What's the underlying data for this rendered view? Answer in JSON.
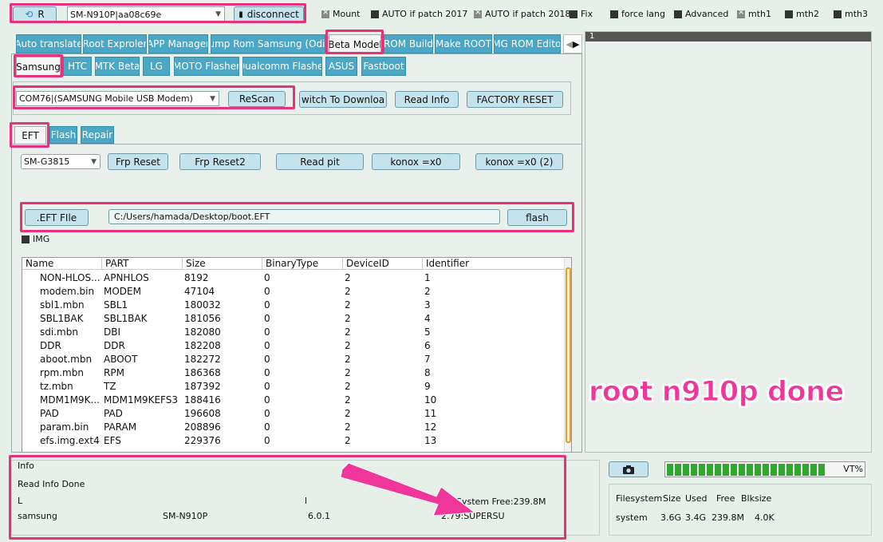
{
  "toolbar": {
    "r_button": "R",
    "device_combo": "SM-N910P|aa08c69e",
    "disconnect_button": "disconnect",
    "checkboxes": [
      {
        "label": "Mount",
        "checked": true
      },
      {
        "label": "AUTO if patch 2017",
        "checked": false
      },
      {
        "label": "AUTO if patch 2018",
        "checked": true
      },
      {
        "label": "Fix",
        "checked": false
      },
      {
        "label": "force lang",
        "checked": false
      },
      {
        "label": "Advanced",
        "checked": false
      },
      {
        "label": "mth1",
        "checked": true
      },
      {
        "label": "mth2",
        "checked": false
      },
      {
        "label": "mth3",
        "checked": false
      }
    ]
  },
  "main_tabs": [
    "Auto translate",
    "Root Exproler",
    "APP Manager",
    "Dump Rom Samsung (Odin)",
    "Beta Model",
    "ROM Build",
    "Make ROOT",
    "IMG ROM Editor"
  ],
  "brand_tabs": [
    "Samsung",
    "HTC",
    "MTK Beta",
    "LG",
    "MOTO Flasher",
    "Qualcomm Flasher",
    "ASUS",
    "Fastboot"
  ],
  "port": {
    "combo": "COM76|(SAMSUNG Mobile USB Modem)",
    "rescan": "ReScan",
    "switch_download": "witch To Downloa",
    "read_info": "Read Info",
    "factory_reset": "FACTORY RESET"
  },
  "sub_tabs": [
    "EFT",
    "Flash",
    "Repair"
  ],
  "eft": {
    "model_combo": "SM-G3815",
    "frp_reset": "Frp Reset",
    "frp_reset2": "Frp Reset2",
    "read_pit": "Read pit",
    "konox": "konox =x0",
    "konox2": "konox =x0 (2)",
    "eft_file_button": ".EFT FIle",
    "path": "C:/Users/hamada/Desktop/boot.EFT",
    "flash_button": "flash",
    "img_label": "IMG"
  },
  "table": {
    "headers": [
      "Name",
      "PART",
      "Size",
      "BinaryType",
      "DeviceID",
      "Identifier"
    ],
    "rows": [
      [
        "NON-HLOS...",
        "APNHLOS",
        "8192",
        "0",
        "2",
        "1"
      ],
      [
        "modem.bin",
        "MODEM",
        "47104",
        "0",
        "2",
        "2"
      ],
      [
        "sbl1.mbn",
        "SBL1",
        "180032",
        "0",
        "2",
        "3"
      ],
      [
        "SBL1BAK",
        "SBL1BAK",
        "181056",
        "0",
        "2",
        "4"
      ],
      [
        "sdi.mbn",
        "DBI",
        "182080",
        "0",
        "2",
        "5"
      ],
      [
        "DDR",
        "DDR",
        "182208",
        "0",
        "2",
        "6"
      ],
      [
        "aboot.mbn",
        "ABOOT",
        "182272",
        "0",
        "2",
        "7"
      ],
      [
        "rpm.mbn",
        "RPM",
        "186368",
        "0",
        "2",
        "8"
      ],
      [
        "tz.mbn",
        "TZ",
        "187392",
        "0",
        "2",
        "9"
      ],
      [
        "MDM1M9K...",
        "MDM1M9KEFS3",
        "188416",
        "0",
        "2",
        "10"
      ],
      [
        "PAD",
        "PAD",
        "196608",
        "0",
        "2",
        "11"
      ],
      [
        "param.bin",
        "PARAM",
        "208896",
        "0",
        "2",
        "12"
      ],
      [
        "efs.img.ext4",
        "EFS",
        "229376",
        "0",
        "2",
        "13"
      ]
    ]
  },
  "log_panel": {
    "line_number": "1",
    "overlay_text": "root n910p done"
  },
  "info": {
    "title": "Info",
    "status": "Read Info Done",
    "l1": "L",
    "l2": "l",
    "system_free": "System Free:239.8M",
    "brand": "samsung",
    "model": "SM-N910P",
    "version": "6.0.1",
    "supersu": "2.79:SUPERSU"
  },
  "progress": {
    "value_percent": 90,
    "label": "VT%"
  },
  "storage": {
    "headers": [
      "Filesystem",
      "Size",
      "Used",
      "Free",
      "Blksize"
    ],
    "row": [
      "system",
      "3.6G",
      "3.4G",
      "239.8M",
      "4.0K"
    ]
  }
}
